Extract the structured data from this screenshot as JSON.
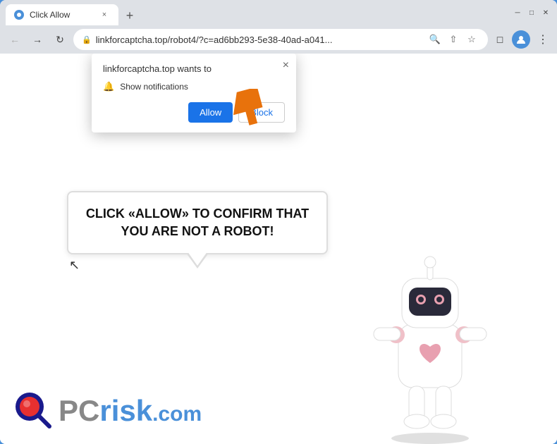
{
  "browser": {
    "tab": {
      "title": "Click Allow",
      "favicon": "●"
    },
    "new_tab_label": "+",
    "window_controls": {
      "minimize": "─",
      "maximize": "□",
      "close": "✕"
    },
    "nav": {
      "back": "←",
      "forward": "→",
      "reload": "↻"
    },
    "url": "linkforcaptcha.top/robot4/?c=ad6bb293-5e38-40ad-a041...",
    "url_actions": {
      "search": "🔍",
      "share": "⇧",
      "bookmark": "☆",
      "extensions": "◻",
      "profile": "👤",
      "menu": "⋮"
    }
  },
  "notification_popup": {
    "title": "linkforcaptcha.top wants to",
    "notification_label": "Show notifications",
    "allow_btn": "Allow",
    "block_btn": "Block",
    "close": "×"
  },
  "page": {
    "speech_text": "CLICK «ALLOW» TO CONFIRM THAT YOU ARE NOT A ROBOT!",
    "logo_text_gray": "PC",
    "logo_text_blue": "risk",
    "logo_domain": ".com"
  }
}
